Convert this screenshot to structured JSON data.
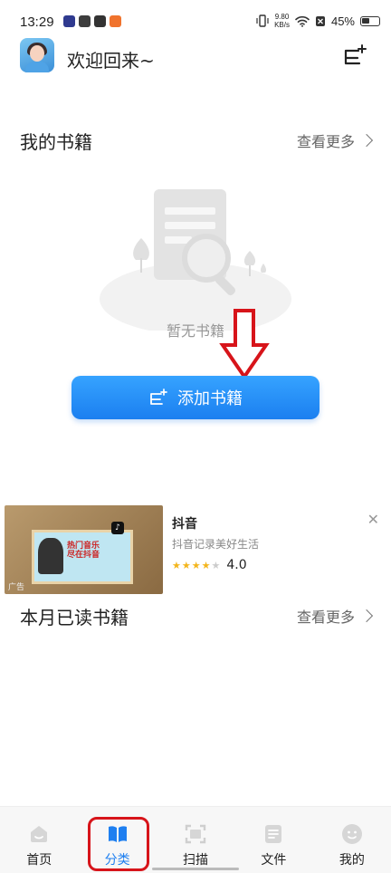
{
  "status_bar": {
    "time": "13:29",
    "net_speed_value": "9.80",
    "net_speed_unit": "KB/s",
    "battery": "45%"
  },
  "header": {
    "welcome": "欢迎回来~",
    "avatar_icon": "user-avatar",
    "action_icon": "add-shelf-icon"
  },
  "my_books": {
    "title": "我的书籍",
    "see_more": "查看更多",
    "empty_text": "暂无书籍",
    "add_button": "添加书籍"
  },
  "ad": {
    "title": "抖音",
    "subtitle": "抖音记录美好生活",
    "rating": 4.0,
    "rating_text": "4.0",
    "badge": "广告",
    "poster_text_line1": "热门音乐",
    "poster_text_line2": "尽在抖音"
  },
  "monthly_books": {
    "title": "本月已读书籍",
    "see_more": "查看更多"
  },
  "bottom_nav": {
    "items": [
      {
        "label": "首页",
        "icon": "home-icon"
      },
      {
        "label": "分类",
        "icon": "category-icon"
      },
      {
        "label": "扫描",
        "icon": "scan-icon"
      },
      {
        "label": "文件",
        "icon": "file-icon"
      },
      {
        "label": "我的",
        "icon": "profile-icon"
      }
    ],
    "active_index": 1
  },
  "colors": {
    "accent": "#1e7ff0",
    "annotation_red": "#d7141a"
  }
}
